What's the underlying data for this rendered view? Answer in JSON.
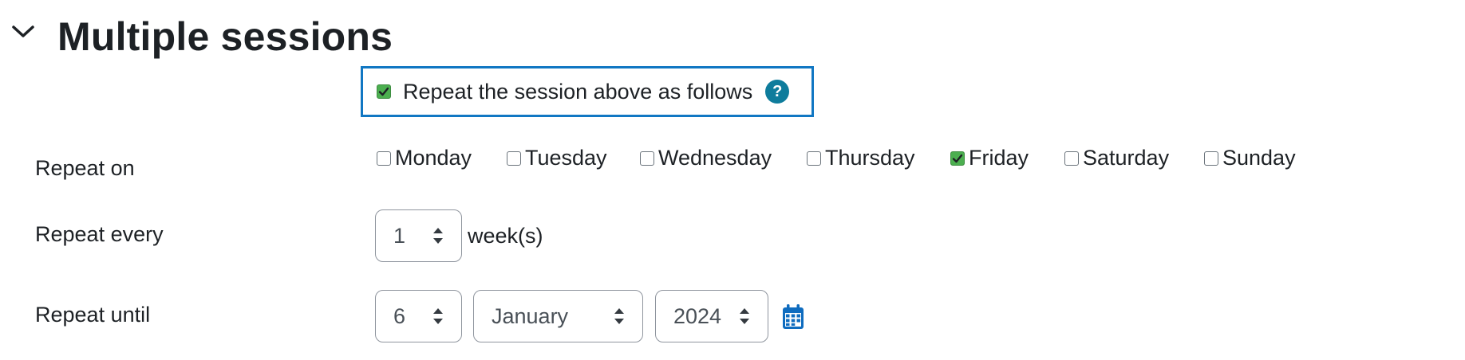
{
  "section": {
    "title": "Multiple sessions"
  },
  "repeat_toggle": {
    "label": "Repeat the session above as follows",
    "checked": true,
    "help": "?"
  },
  "repeat_on": {
    "label": "Repeat on",
    "days": [
      {
        "name": "Monday",
        "checked": false
      },
      {
        "name": "Tuesday",
        "checked": false
      },
      {
        "name": "Wednesday",
        "checked": false
      },
      {
        "name": "Thursday",
        "checked": false
      },
      {
        "name": "Friday",
        "checked": true
      },
      {
        "name": "Saturday",
        "checked": false
      },
      {
        "name": "Sunday",
        "checked": false
      }
    ]
  },
  "repeat_every": {
    "label": "Repeat every",
    "value": "1",
    "unit": "week(s)"
  },
  "repeat_until": {
    "label": "Repeat until",
    "day": "6",
    "month": "January",
    "year": "2024"
  },
  "colors": {
    "accent": "#0f6cbf",
    "checkbox_checked": "#4caf50",
    "focus_border": "#1177c3",
    "help_icon": "#0e7c9c"
  },
  "icons": {
    "collapse": "chevron-down-icon",
    "help": "help-icon",
    "calendar": "calendar-icon",
    "select_arrows": "select-arrows-icon",
    "check": "check-icon"
  }
}
